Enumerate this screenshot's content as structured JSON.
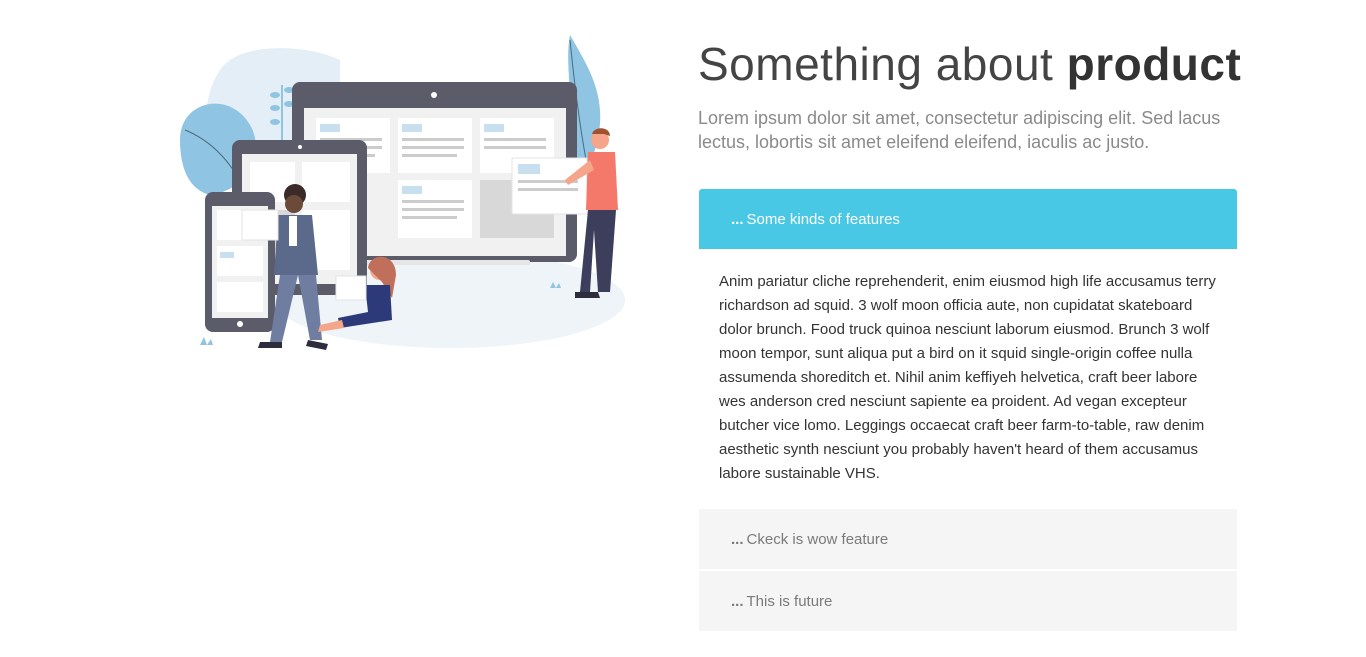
{
  "section": {
    "title_regular": "Something about ",
    "title_bold": "product",
    "lead": "Lorem ipsum dolor sit amet, consectetur adipiscing elit. Sed lacus lectus, lobortis sit amet eleifend eleifend, iaculis ac justo."
  },
  "accordion": {
    "items": [
      {
        "dots": "...",
        "label": "Some kinds of features",
        "expanded": true,
        "body": "Anim pariatur cliche reprehenderit, enim eiusmod high life accusamus terry richardson ad squid. 3 wolf moon officia aute, non cupidatat skateboard dolor brunch. Food truck quinoa nesciunt laborum eiusmod. Brunch 3 wolf moon tempor, sunt aliqua put a bird on it squid single-origin coffee nulla assumenda shoreditch et. Nihil anim keffiyeh helvetica, craft beer labore wes anderson cred nesciunt sapiente ea proident. Ad vegan excepteur butcher vice lomo. Leggings occaecat craft beer farm-to-table, raw denim aesthetic synth nesciunt you probably haven't heard of them accusamus labore sustainable VHS."
      },
      {
        "dots": "...",
        "label": "Ckeck is wow feature",
        "expanded": false
      },
      {
        "dots": "...",
        "label": "This is future",
        "expanded": false
      }
    ]
  },
  "colors": {
    "accent": "#48c8e4",
    "collapsed_bg": "#f5f5f5",
    "heading": "#444444",
    "lead": "#8a8a8a"
  }
}
